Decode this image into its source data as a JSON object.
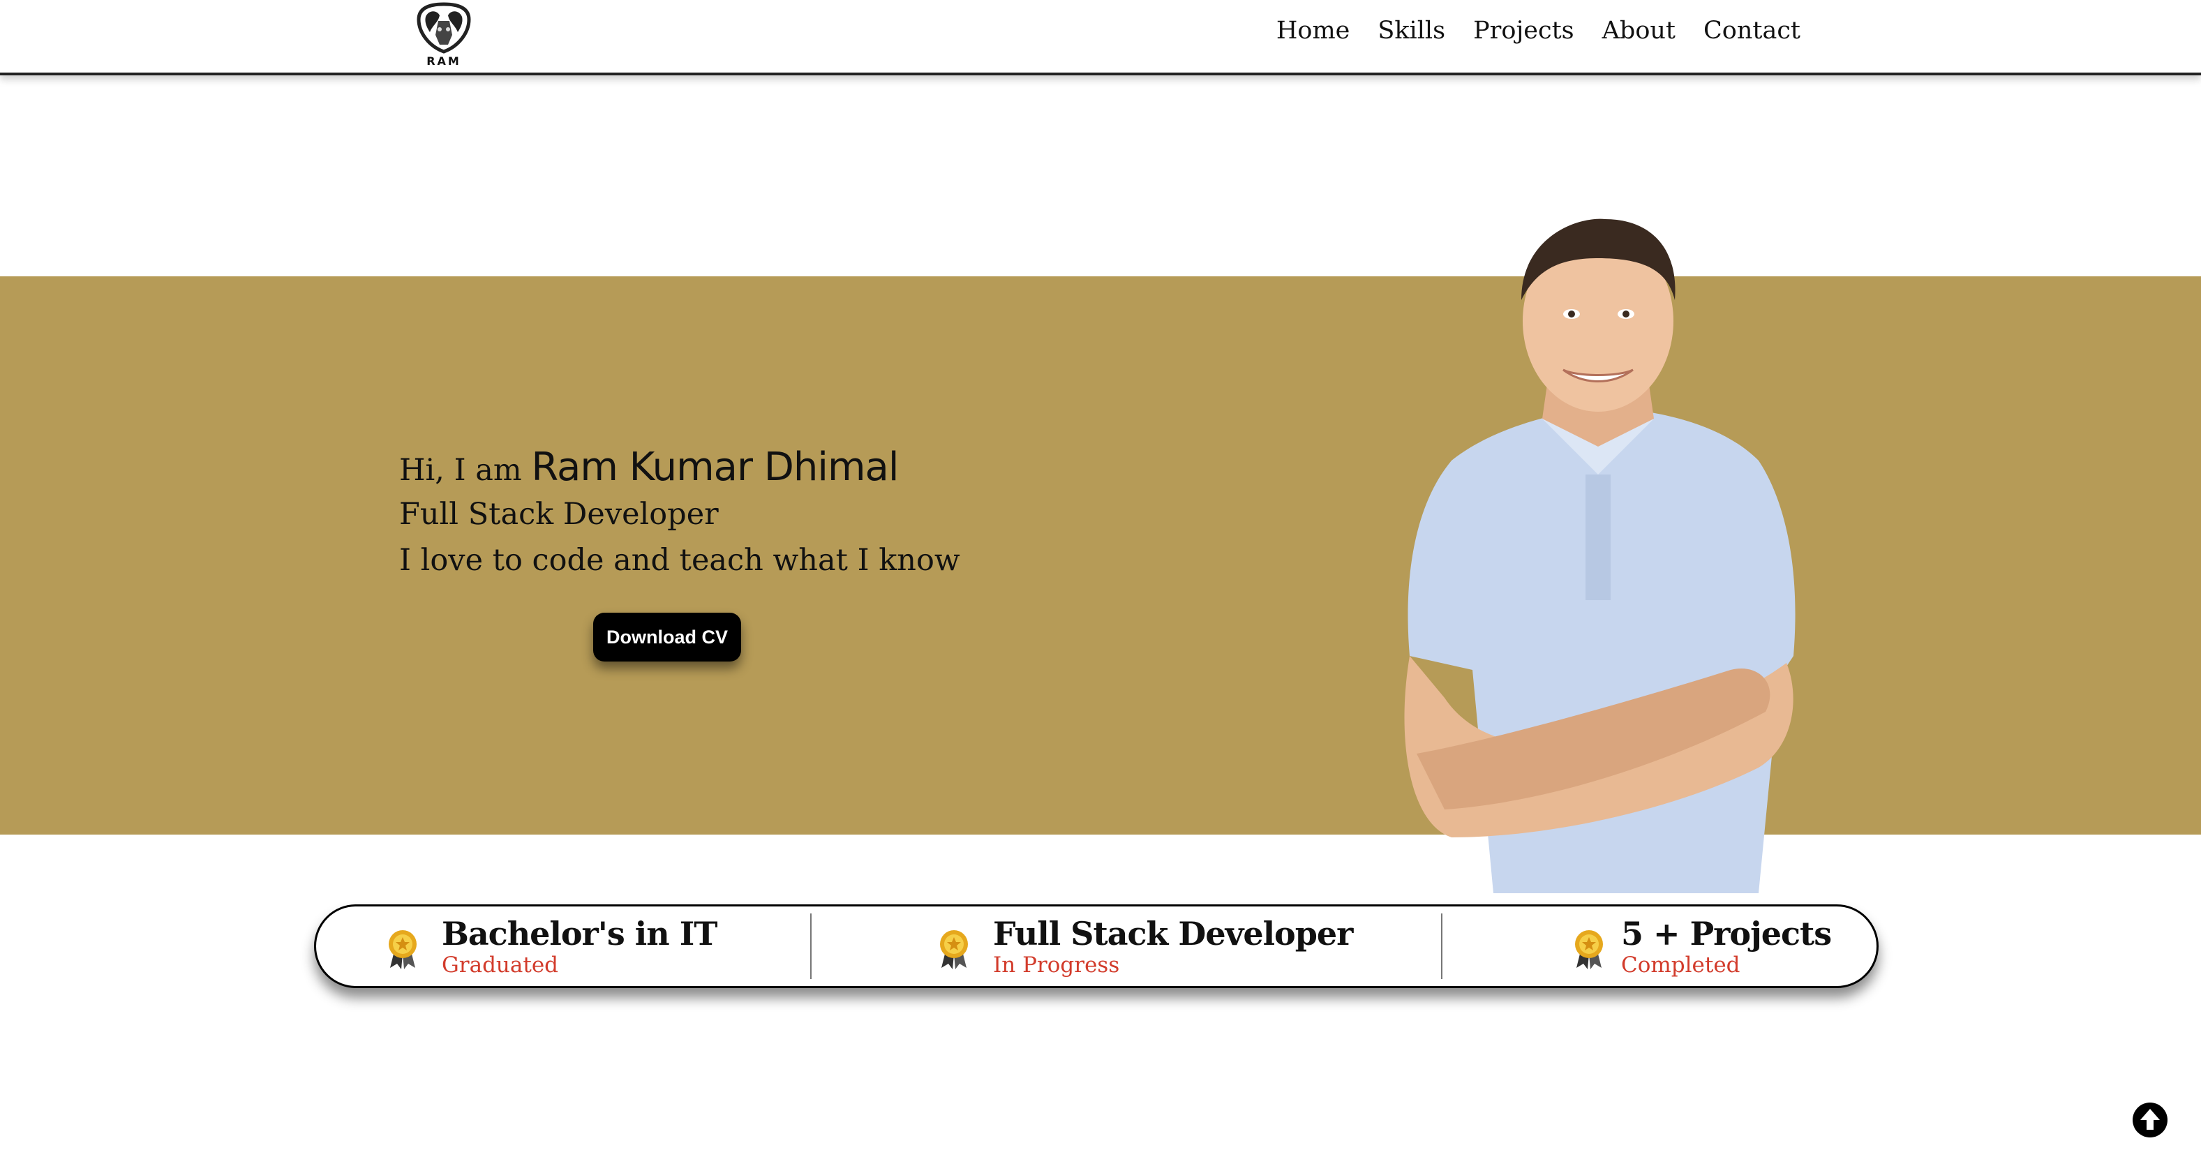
{
  "brand": {
    "logo_text": "RAM"
  },
  "nav": {
    "items": [
      "Home",
      "Skills",
      "Projects",
      "About",
      "Contact"
    ]
  },
  "hero": {
    "greeting": "Hi, I am",
    "name": "Ram Kumar Dhimal",
    "role": "Full Stack Developer",
    "tagline": "I love to code and teach what I know",
    "cta_label": "Download CV"
  },
  "stats": [
    {
      "title": "Bachelor's in IT",
      "subtitle": "Graduated",
      "icon": "medal-icon"
    },
    {
      "title": "Full Stack Developer",
      "subtitle": "In Progress",
      "icon": "medal-icon"
    },
    {
      "title": "5 + Projects",
      "subtitle": "Completed",
      "icon": "medal-icon"
    }
  ],
  "scroll_top_icon": "arrow-up-circle-icon",
  "colors": {
    "hero_band": "#b69b57",
    "accent_text": "#d23b2b",
    "button": "#000000"
  }
}
